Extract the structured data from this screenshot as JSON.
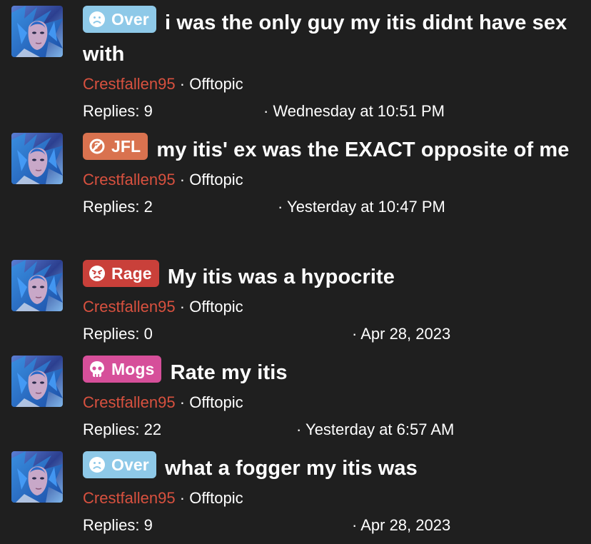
{
  "threads": [
    {
      "prefix": {
        "label": "Over",
        "icon": "sad-face-icon",
        "color": "#8ec9e8"
      },
      "title": "i was the only guy my itis didnt have sex with",
      "author": "Crestfallen95",
      "separator": "·",
      "forum": "Offtopic",
      "replies": "Replies: 9",
      "date": "· Wednesday at 10:51 PM"
    },
    {
      "prefix": {
        "label": "JFL",
        "icon": "no-symbol-icon",
        "color": "#d9724f"
      },
      "title": "my itis' ex was the EXACT opposite of me",
      "author": "Crestfallen95",
      "separator": "·",
      "forum": "Offtopic",
      "replies": "Replies: 2",
      "date": "· Yesterday at 10:47 PM"
    },
    {
      "prefix": {
        "label": "Rage",
        "icon": "angry-face-icon",
        "color": "#c9403a"
      },
      "title": "My itis was a hypocrite",
      "author": "Crestfallen95",
      "separator": "·",
      "forum": "Offtopic",
      "replies": "Replies: 0",
      "date": "· Apr 28, 2023"
    },
    {
      "prefix": {
        "label": "Mogs",
        "icon": "skull-icon",
        "color": "#d64f9a"
      },
      "title": "Rate my itis",
      "author": "Crestfallen95",
      "separator": "·",
      "forum": "Offtopic",
      "replies": "Replies: 22",
      "date": "· Yesterday at 6:57 AM"
    },
    {
      "prefix": {
        "label": "Over",
        "icon": "sad-face-icon",
        "color": "#8ec9e8"
      },
      "title": "what a fogger my itis was",
      "author": "Crestfallen95",
      "separator": "·",
      "forum": "Offtopic",
      "replies": "Replies: 9",
      "date": "· Apr 28, 2023"
    }
  ]
}
